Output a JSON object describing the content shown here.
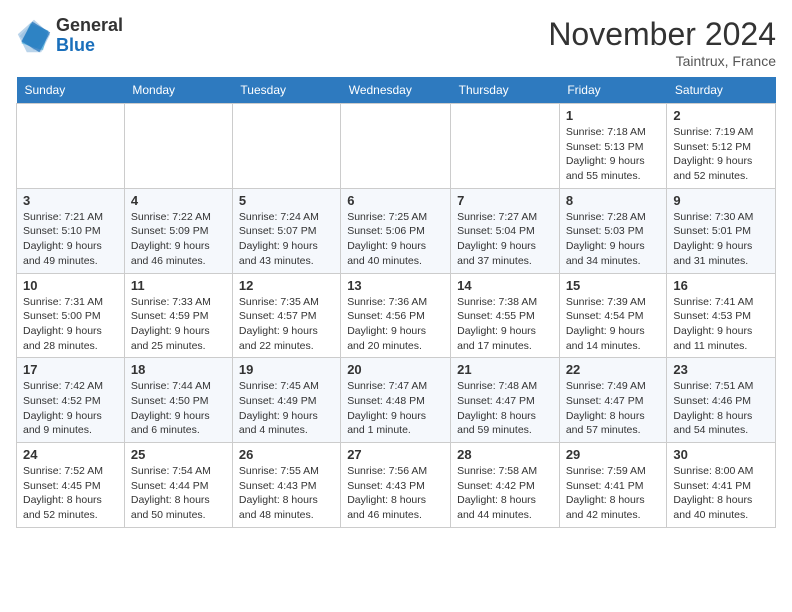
{
  "header": {
    "logo_general": "General",
    "logo_blue": "Blue",
    "month_title": "November 2024",
    "location": "Taintrux, France"
  },
  "weekdays": [
    "Sunday",
    "Monday",
    "Tuesday",
    "Wednesday",
    "Thursday",
    "Friday",
    "Saturday"
  ],
  "weeks": [
    [
      {
        "day": "",
        "info": ""
      },
      {
        "day": "",
        "info": ""
      },
      {
        "day": "",
        "info": ""
      },
      {
        "day": "",
        "info": ""
      },
      {
        "day": "",
        "info": ""
      },
      {
        "day": "1",
        "info": "Sunrise: 7:18 AM\nSunset: 5:13 PM\nDaylight: 9 hours and 55 minutes."
      },
      {
        "day": "2",
        "info": "Sunrise: 7:19 AM\nSunset: 5:12 PM\nDaylight: 9 hours and 52 minutes."
      }
    ],
    [
      {
        "day": "3",
        "info": "Sunrise: 7:21 AM\nSunset: 5:10 PM\nDaylight: 9 hours and 49 minutes."
      },
      {
        "day": "4",
        "info": "Sunrise: 7:22 AM\nSunset: 5:09 PM\nDaylight: 9 hours and 46 minutes."
      },
      {
        "day": "5",
        "info": "Sunrise: 7:24 AM\nSunset: 5:07 PM\nDaylight: 9 hours and 43 minutes."
      },
      {
        "day": "6",
        "info": "Sunrise: 7:25 AM\nSunset: 5:06 PM\nDaylight: 9 hours and 40 minutes."
      },
      {
        "day": "7",
        "info": "Sunrise: 7:27 AM\nSunset: 5:04 PM\nDaylight: 9 hours and 37 minutes."
      },
      {
        "day": "8",
        "info": "Sunrise: 7:28 AM\nSunset: 5:03 PM\nDaylight: 9 hours and 34 minutes."
      },
      {
        "day": "9",
        "info": "Sunrise: 7:30 AM\nSunset: 5:01 PM\nDaylight: 9 hours and 31 minutes."
      }
    ],
    [
      {
        "day": "10",
        "info": "Sunrise: 7:31 AM\nSunset: 5:00 PM\nDaylight: 9 hours and 28 minutes."
      },
      {
        "day": "11",
        "info": "Sunrise: 7:33 AM\nSunset: 4:59 PM\nDaylight: 9 hours and 25 minutes."
      },
      {
        "day": "12",
        "info": "Sunrise: 7:35 AM\nSunset: 4:57 PM\nDaylight: 9 hours and 22 minutes."
      },
      {
        "day": "13",
        "info": "Sunrise: 7:36 AM\nSunset: 4:56 PM\nDaylight: 9 hours and 20 minutes."
      },
      {
        "day": "14",
        "info": "Sunrise: 7:38 AM\nSunset: 4:55 PM\nDaylight: 9 hours and 17 minutes."
      },
      {
        "day": "15",
        "info": "Sunrise: 7:39 AM\nSunset: 4:54 PM\nDaylight: 9 hours and 14 minutes."
      },
      {
        "day": "16",
        "info": "Sunrise: 7:41 AM\nSunset: 4:53 PM\nDaylight: 9 hours and 11 minutes."
      }
    ],
    [
      {
        "day": "17",
        "info": "Sunrise: 7:42 AM\nSunset: 4:52 PM\nDaylight: 9 hours and 9 minutes."
      },
      {
        "day": "18",
        "info": "Sunrise: 7:44 AM\nSunset: 4:50 PM\nDaylight: 9 hours and 6 minutes."
      },
      {
        "day": "19",
        "info": "Sunrise: 7:45 AM\nSunset: 4:49 PM\nDaylight: 9 hours and 4 minutes."
      },
      {
        "day": "20",
        "info": "Sunrise: 7:47 AM\nSunset: 4:48 PM\nDaylight: 9 hours and 1 minute."
      },
      {
        "day": "21",
        "info": "Sunrise: 7:48 AM\nSunset: 4:47 PM\nDaylight: 8 hours and 59 minutes."
      },
      {
        "day": "22",
        "info": "Sunrise: 7:49 AM\nSunset: 4:47 PM\nDaylight: 8 hours and 57 minutes."
      },
      {
        "day": "23",
        "info": "Sunrise: 7:51 AM\nSunset: 4:46 PM\nDaylight: 8 hours and 54 minutes."
      }
    ],
    [
      {
        "day": "24",
        "info": "Sunrise: 7:52 AM\nSunset: 4:45 PM\nDaylight: 8 hours and 52 minutes."
      },
      {
        "day": "25",
        "info": "Sunrise: 7:54 AM\nSunset: 4:44 PM\nDaylight: 8 hours and 50 minutes."
      },
      {
        "day": "26",
        "info": "Sunrise: 7:55 AM\nSunset: 4:43 PM\nDaylight: 8 hours and 48 minutes."
      },
      {
        "day": "27",
        "info": "Sunrise: 7:56 AM\nSunset: 4:43 PM\nDaylight: 8 hours and 46 minutes."
      },
      {
        "day": "28",
        "info": "Sunrise: 7:58 AM\nSunset: 4:42 PM\nDaylight: 8 hours and 44 minutes."
      },
      {
        "day": "29",
        "info": "Sunrise: 7:59 AM\nSunset: 4:41 PM\nDaylight: 8 hours and 42 minutes."
      },
      {
        "day": "30",
        "info": "Sunrise: 8:00 AM\nSunset: 4:41 PM\nDaylight: 8 hours and 40 minutes."
      }
    ]
  ]
}
